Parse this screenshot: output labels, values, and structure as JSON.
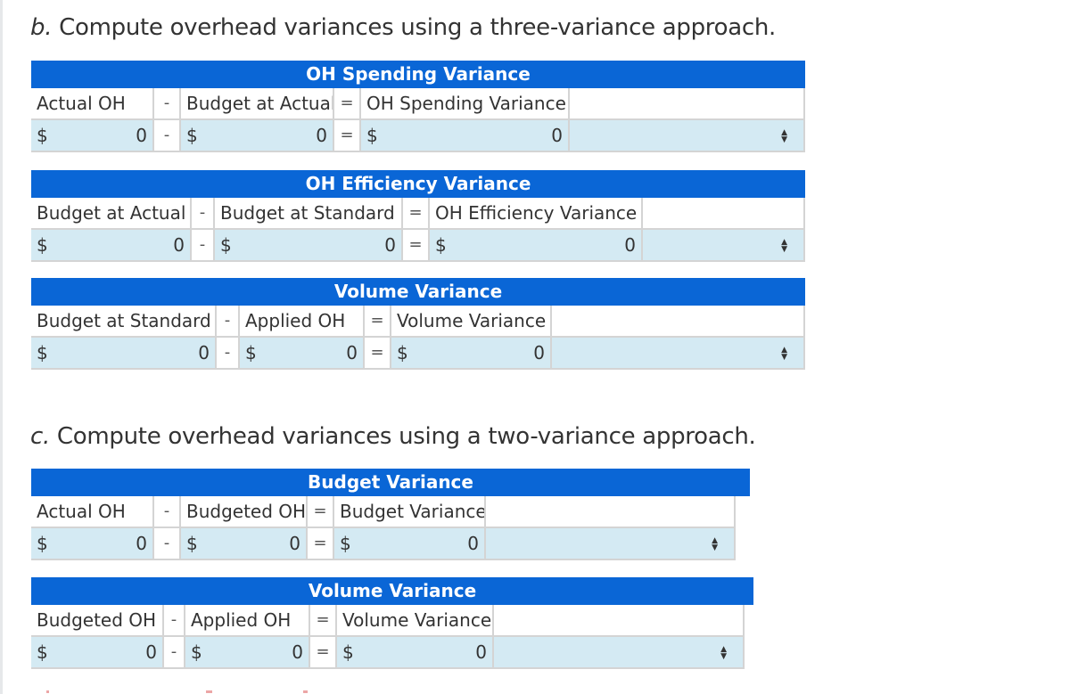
{
  "part_b": {
    "prefix": "b.",
    "title": " Compute overhead variances using a three-variance approach.",
    "tables": [
      {
        "header": "OH Spending Variance",
        "labels": [
          "Actual OH",
          "-",
          "Budget at Actual",
          "=",
          "OH Spending Variance"
        ],
        "currency": "$",
        "values": [
          "0",
          "-",
          "0",
          "=",
          "0"
        ],
        "select_value": "",
        "select_icon": "up-down-arrows"
      },
      {
        "header": "OH Efficiency Variance",
        "labels": [
          "Budget at Actual",
          "-",
          "Budget at Standard",
          "=",
          "OH Efficiency Variance"
        ],
        "currency": "$",
        "values": [
          "0",
          "-",
          "0",
          "=",
          "0"
        ],
        "select_value": "",
        "select_icon": "up-down-arrows"
      },
      {
        "header": "Volume Variance",
        "labels": [
          "Budget at Standard",
          "-",
          "Applied OH",
          "=",
          "Volume Variance"
        ],
        "currency": "$",
        "values": [
          "0",
          "-",
          "0",
          "=",
          "0"
        ],
        "select_value": "",
        "select_icon": "up-down-arrows"
      }
    ]
  },
  "part_c": {
    "prefix": "c.",
    "title": " Compute overhead variances using a two-variance approach.",
    "tables": [
      {
        "header": "Budget Variance",
        "labels": [
          "Actual OH",
          "-",
          "Budgeted OH",
          "=",
          "Budget Variance"
        ],
        "currency": "$",
        "values": [
          "0",
          "-",
          "0",
          "=",
          "0"
        ],
        "select_value": "",
        "select_icon": "up-down-arrows"
      },
      {
        "header": "Volume Variance",
        "labels": [
          "Budgeted OH",
          "-",
          "Applied OH",
          "=",
          "Volume Variance"
        ],
        "currency": "$",
        "values": [
          "0",
          "-",
          "0",
          "=",
          "0"
        ],
        "select_value": "",
        "select_icon": "up-down-arrows"
      }
    ]
  },
  "glyphs": {
    "select_arrow": "▲▼"
  }
}
